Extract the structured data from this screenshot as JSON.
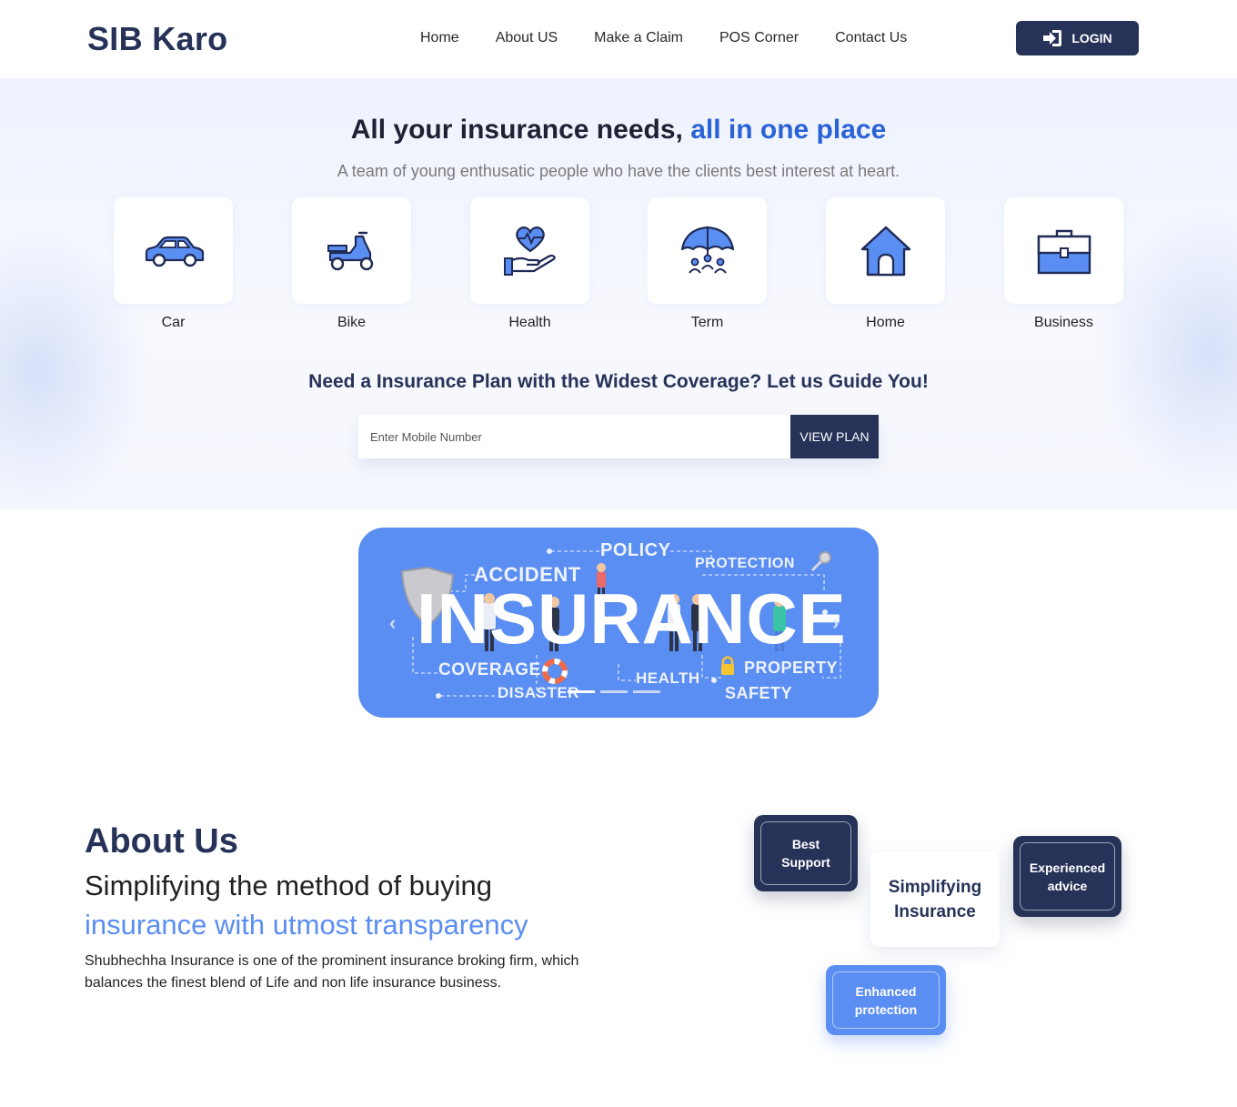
{
  "brand": {
    "name": "SIB Karo"
  },
  "nav": {
    "items": [
      "Home",
      "About US",
      "Make a Claim",
      "POS Corner",
      "Contact Us"
    ],
    "login_label": "LOGIN"
  },
  "hero": {
    "title_main": "All your insurance needs, ",
    "title_accent": "all in one place",
    "subtitle": "A team of young enthusatic people who have the clients best interest at heart.",
    "categories": [
      {
        "label": "Car",
        "icon": "car-icon"
      },
      {
        "label": "Bike",
        "icon": "scooter-icon"
      },
      {
        "label": "Health",
        "icon": "heart-hand-icon"
      },
      {
        "label": "Term",
        "icon": "umbrella-family-icon"
      },
      {
        "label": "Home",
        "icon": "house-icon"
      },
      {
        "label": "Business",
        "icon": "briefcase-icon"
      }
    ],
    "guide_title": "Need a Insurance Plan with the Widest Coverage? Let us Guide You!",
    "mobile_placeholder": "Enter Mobile Number",
    "view_plan_label": "VIEW PLAN"
  },
  "banner": {
    "big_word": "INSURANCE",
    "words": [
      "POLICY",
      "ACCIDENT",
      "PROTECTION",
      "COVERAGE",
      "HEALTH",
      "PROPERTY",
      "DISASTER",
      "SAFETY"
    ],
    "prev_label": "‹",
    "next_label": "›",
    "slides": 3,
    "active_slide": 1
  },
  "about": {
    "title": "About Us",
    "line1": "Simplifying the method of buying",
    "line2": "insurance with utmost transparency",
    "paragraph": "Shubhechha Insurance is one of the prominent insurance broking firm, which balances the finest blend of Life and non life insurance business.",
    "tiles": {
      "best_support": "Best Support",
      "simplifying": "Simplifying Insurance",
      "experienced": "Experienced advice",
      "enhanced": "Enhanced protection"
    }
  },
  "colors": {
    "navy": "#263258",
    "accent_blue": "#2b63d6",
    "banner_blue": "#5b8ef2"
  }
}
